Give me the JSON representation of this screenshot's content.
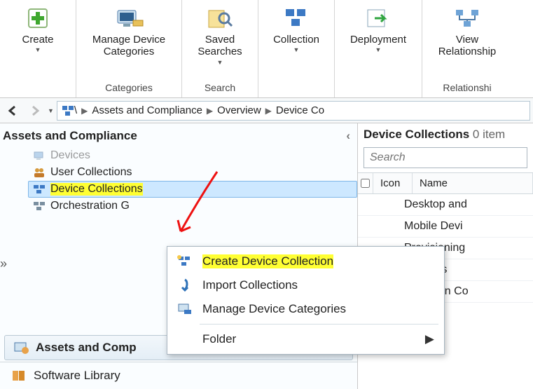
{
  "ribbon": {
    "create": {
      "label": "Create"
    },
    "manage_categories": {
      "label": "Manage Device Categories",
      "group": "Categories"
    },
    "saved_searches": {
      "label": "Saved Searches",
      "group": "Search"
    },
    "collection": {
      "label": "Collection"
    },
    "deployment": {
      "label": "Deployment"
    },
    "view_relationships": {
      "label": "View Relationship",
      "group": "Relationshi"
    }
  },
  "breadcrumb": {
    "segments": [
      "\\",
      "Assets and Compliance",
      "Overview",
      "Device Co"
    ]
  },
  "nav": {
    "title": "Assets and Compliance",
    "items": [
      {
        "label": "Devices"
      },
      {
        "label": "User Collections"
      },
      {
        "label": "Device Collections",
        "selected": true,
        "highlight": true
      },
      {
        "label": "Orchestration G"
      }
    ],
    "workspaces": [
      {
        "label": "Assets and Comp",
        "active": true
      },
      {
        "label": "Software Library",
        "active": false
      }
    ]
  },
  "list": {
    "title": "Device Collections",
    "count_text": "0 item",
    "search_placeholder": "Search",
    "columns": [
      "Icon",
      "Name"
    ],
    "rows": [
      {
        "name": "Desktop and"
      },
      {
        "name": "Mobile Devi"
      },
      {
        "name": "Provisioning"
      },
      {
        "name": "Systems"
      },
      {
        "name": "Unknown Co"
      }
    ]
  },
  "context_menu": {
    "items": [
      {
        "label": "Create Device Collection",
        "highlight": true,
        "icon": "new-collection"
      },
      {
        "label": "Import Collections",
        "icon": "import"
      },
      {
        "label": "Manage Device Categories",
        "icon": "manage"
      }
    ],
    "folder_label": "Folder"
  }
}
